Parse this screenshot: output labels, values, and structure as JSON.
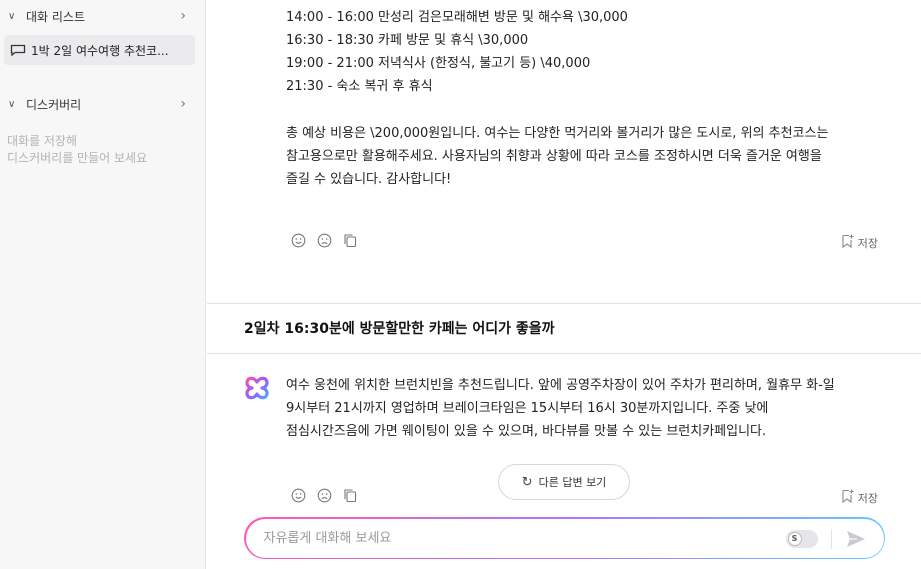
{
  "sidebar": {
    "conversation_list_label": "대화 리스트",
    "chat_items": [
      "1박 2일 여수여행 추천코..."
    ],
    "discovery_label": "디스커버리",
    "discovery_hint_line1": "대화를 저장해",
    "discovery_hint_line2": "디스커버리를 만들어 보세요"
  },
  "answer1": {
    "lines": [
      "14:00 - 16:00 만성리 검은모래해변 방문 및 해수욕 \\30,000",
      "16:30 - 18:30 카페 방문 및 휴식 \\30,000",
      "19:00 - 21:00 저녁식사 (한정식, 불고기 등) \\40,000",
      "21:30 - 숙소 복귀 후 휴식"
    ],
    "summary": [
      "총 예상 비용은 \\200,000원입니다. 여수는 다양한 먹거리와 볼거리가 많은 도시로, 위의 추천코스는",
      "참고용으로만 활용해주세요. 사용자님의 취향과 상황에 따라 코스를 조정하시면 더욱 즐거운 여행을",
      "즐길 수 있습니다. 감사합니다!"
    ],
    "save_label": "저장"
  },
  "question": "2일차 16:30분에 방문할만한 카페는 어디가 좋을까",
  "answer2": {
    "lines": [
      "여수 웅천에 위치한 브런치빈을 추천드립니다. 앞에 공영주차장이 있어 주차가 편리하며, 월휴무 화-일",
      "9시부터 21시까지 영업하며 브레이크타임은 15시부터 16시 30분까지입니다. 주중 낮에",
      "점심시간즈음에 가면 웨이팅이 있을 수 있으며, 바다뷰를 맛볼 수 있는 브런치카페입니다."
    ],
    "regenerate_label": "다른 답변 보기",
    "save_label": "저장"
  },
  "input": {
    "placeholder": "자유롭게 대화해 보세요"
  },
  "colors": {
    "accent_pink": "#ff5ab3",
    "accent_purple": "#a77bff",
    "accent_blue": "#66c8ff",
    "sidebar_bg": "#f7f7f8"
  }
}
